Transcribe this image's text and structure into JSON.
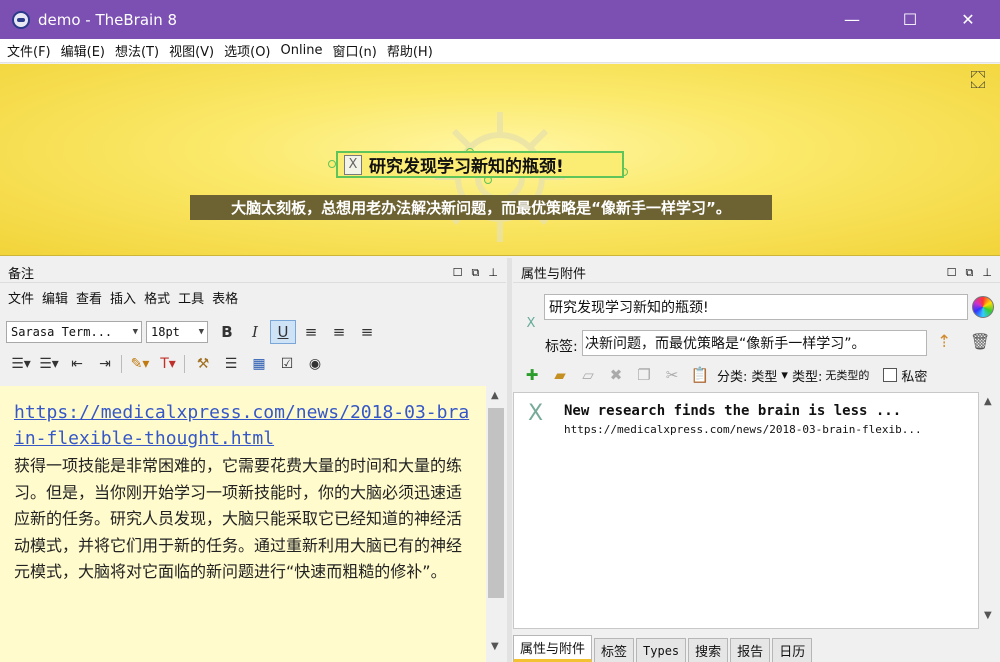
{
  "window": {
    "title": "demo - TheBrain 8",
    "minimize": "—",
    "maximize": "☐",
    "close": "✕"
  },
  "menu": [
    "文件(F)",
    "编辑(E)",
    "想法(T)",
    "视图(V)",
    "选项(O)",
    "Online",
    "窗口(n)",
    "帮助(H)"
  ],
  "plex": {
    "thought_label": "研究发现学习新知的瓶颈!",
    "thought_caption": "大脑太刻板，总想用老办法解决新问题，而最优策略是“像新手一样学习”。",
    "background_color": "#f8e35a"
  },
  "notes": {
    "title": "备注",
    "menu": [
      "文件",
      "编辑",
      "查看",
      "插入",
      "格式",
      "工具",
      "表格"
    ],
    "font": "Sarasa Term...",
    "size": "18pt",
    "link": "https://medicalxpress.com/news/2018-03-brain-flexible-thought.html",
    "body": "获得一项技能是非常困难的，它需要花费大量的时间和大量的练习。但是，当你刚开始学习一项新技能时，你的大脑必须迅速适应新的任务。研究人员发现，大脑只能采取它已经知道的神经活动模式，并将它们用于新的任务。通过重新利用大脑已有的神经元模式，大脑将对它面临的新问题进行“快速而粗糙的修补”。"
  },
  "properties": {
    "title": "属性与附件",
    "name_value": "研究发现学习新知的瓶颈!",
    "tag_label": "标签:",
    "tag_value": "决新问题，而最优策略是“像新手一样学习”。",
    "category_label": "分类:",
    "category_value": "类型",
    "type_label": "类型:",
    "type_value": "无类型的",
    "private_label": "私密",
    "attachment": {
      "title": "New research finds the brain is less ...",
      "url": "https://medicalxpress.com/news/2018-03-brain-flexib..."
    },
    "tabs": [
      "属性与附件",
      "标签",
      "Types",
      "搜索",
      "报告",
      "日历"
    ]
  }
}
